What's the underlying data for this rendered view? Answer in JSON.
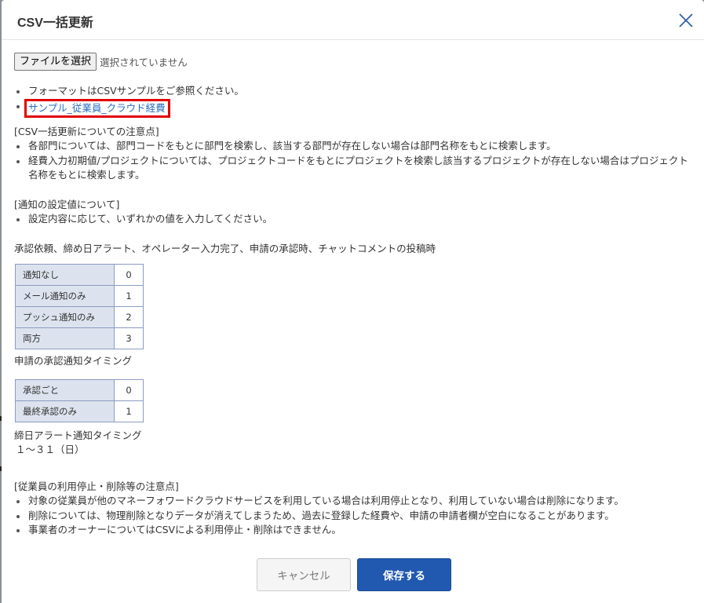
{
  "modal": {
    "title": "CSV一括更新"
  },
  "file": {
    "button_label": "ファイルを選択",
    "status": "選択されていません"
  },
  "format": {
    "note": "フォーマットはCSVサンプルをご参照ください。",
    "sample_link": "サンプル_従業員_クラウド経費"
  },
  "update_notes": {
    "heading": "[CSV一括更新についての注意点]",
    "items": [
      "各部門については、部門コードをもとに部門を検索し、該当する部門が存在しない場合は部門名称をもとに検索します。",
      "経費入力初期値/プロジェクトについては、プロジェクトコードをもとにプロジェクトを検索し該当するプロジェクトが存在しない場合はプロジェクト名称をもとに検索します。"
    ]
  },
  "notify_settings": {
    "heading": "[通知の設定値について]",
    "items": [
      "設定内容に応じて、いずれかの値を入力してください。"
    ],
    "group1_label": "承認依頼、締め日アラート、オペレーター入力完了、申請の承認時、チャットコメントの投稿時",
    "group1_rows": [
      {
        "k": "通知なし",
        "v": "0"
      },
      {
        "k": "メール通知のみ",
        "v": "1"
      },
      {
        "k": "プッシュ通知のみ",
        "v": "2"
      },
      {
        "k": "両方",
        "v": "3"
      }
    ],
    "group2_label": "申請の承認通知タイミング",
    "group2_rows": [
      {
        "k": "承認ごと",
        "v": "0"
      },
      {
        "k": "最終承認のみ",
        "v": "1"
      }
    ],
    "group3_label": "締日アラート通知タイミング",
    "group3_value": "１〜３１（日）"
  },
  "employee_notes": {
    "heading": "[従業員の利用停止・削除等の注意点]",
    "items": [
      "対象の従業員が他のマネーフォワードクラウドサービスを利用している場合は利用停止となり、利用していない場合は削除になります。",
      "削除については、物理削除となりデータが消えてしまうため、過去に登録した経費や、申請の申請者欄が空白になることがあります。",
      "事業者のオーナーについてはCSVによる利用停止・削除はできません。"
    ]
  },
  "footer": {
    "cancel_label": "キャンセル",
    "save_label": "保存する"
  },
  "colors": {
    "primary": "#2159b0",
    "link": "#2a6cc1",
    "highlight": "#e00000",
    "table_header_bg": "#dde3ee"
  }
}
